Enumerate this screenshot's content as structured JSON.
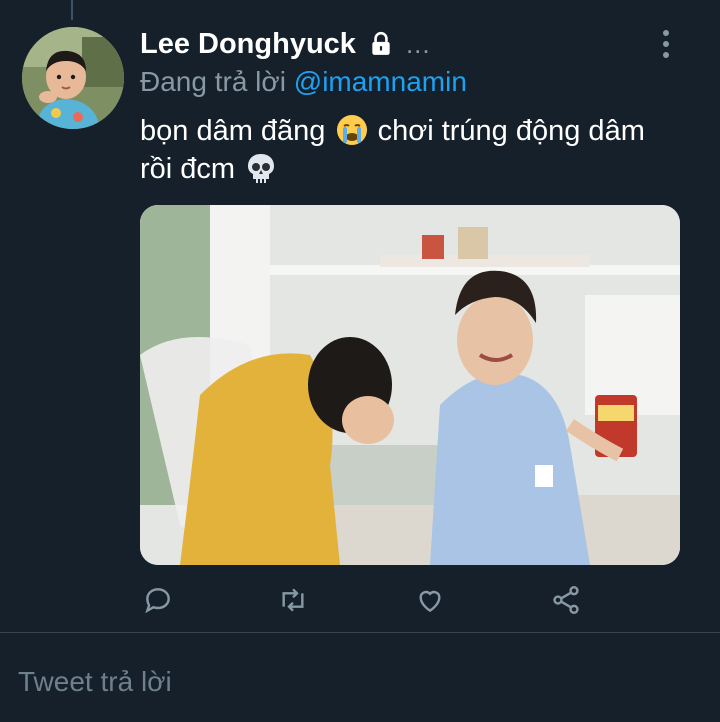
{
  "tweet": {
    "display_name": "Lee Donghyuck",
    "name_overflow": "...",
    "reply_prefix": "Đang trả lời",
    "reply_handle": "@imamnamin",
    "text_part1": "bọn dâm đãng",
    "text_part2": "chơi trúng động dâm rồi đcm",
    "emoji_1": "loudly-crying-face-emoji",
    "emoji_2": "skull-emoji"
  },
  "icons": {
    "lock": "lock-icon",
    "more": "more-vertical-icon",
    "reply": "reply-icon",
    "retweet": "retweet-icon",
    "like": "heart-icon",
    "share": "share-icon"
  },
  "composer": {
    "placeholder": "Tweet trả lời"
  },
  "colors": {
    "background": "#15202b",
    "accent": "#1da1f2",
    "secondary_text": "#8899a6",
    "divider": "#38444d"
  }
}
